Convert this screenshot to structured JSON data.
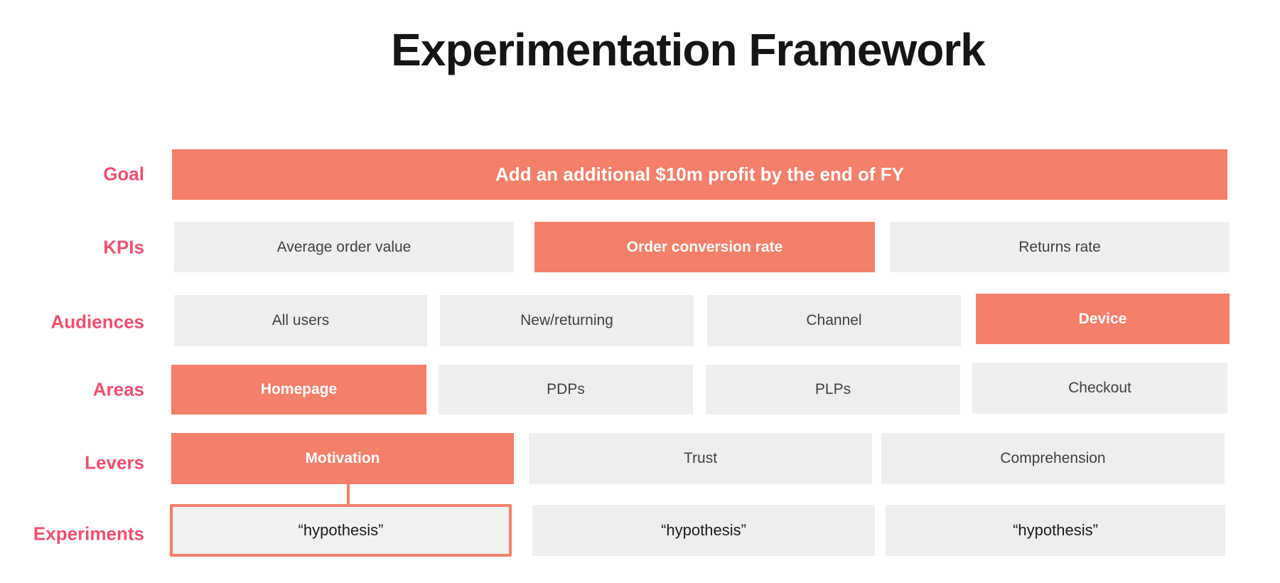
{
  "title": "Experimentation Framework",
  "colors": {
    "accent": "#f47f6b",
    "label": "#f0506e",
    "neutral_box": "#eeeeee",
    "neutral_text": "#3f3f3f"
  },
  "rows": {
    "goal": {
      "label": "Goal",
      "items": [
        {
          "text": "Add an additional $10m profit by the end of FY",
          "selected": true
        }
      ]
    },
    "kpis": {
      "label": "KPIs",
      "items": [
        {
          "text": "Average order value",
          "selected": false
        },
        {
          "text": "Order conversion rate",
          "selected": true
        },
        {
          "text": "Returns rate",
          "selected": false
        }
      ]
    },
    "audiences": {
      "label": "Audiences",
      "items": [
        {
          "text": "All users",
          "selected": false
        },
        {
          "text": "New/returning",
          "selected": false
        },
        {
          "text": "Channel",
          "selected": false
        },
        {
          "text": "Device",
          "selected": true
        }
      ]
    },
    "areas": {
      "label": "Areas",
      "items": [
        {
          "text": "Homepage",
          "selected": true
        },
        {
          "text": "PDPs",
          "selected": false
        },
        {
          "text": "PLPs",
          "selected": false
        },
        {
          "text": "Checkout",
          "selected": false
        }
      ]
    },
    "levers": {
      "label": "Levers",
      "items": [
        {
          "text": "Motivation",
          "selected": true
        },
        {
          "text": "Trust",
          "selected": false
        },
        {
          "text": "Comprehension",
          "selected": false
        }
      ]
    },
    "experiments": {
      "label": "Experiments",
      "items": [
        {
          "text": "“hypothesis”",
          "selected": true
        },
        {
          "text": "“hypothesis”",
          "selected": false
        },
        {
          "text": "“hypothesis”",
          "selected": false
        }
      ]
    }
  }
}
